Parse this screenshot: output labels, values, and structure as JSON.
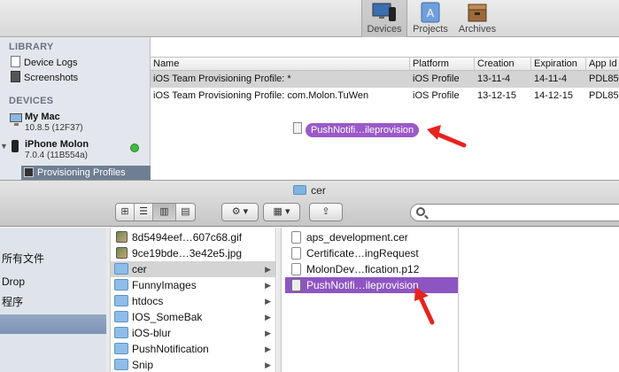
{
  "organizer": {
    "toolbar": [
      {
        "label": "Devices",
        "icon": "devices-icon",
        "active": true
      },
      {
        "label": "Projects",
        "icon": "projects-icon",
        "active": false
      },
      {
        "label": "Archives",
        "icon": "archives-icon",
        "active": false
      }
    ],
    "sidebar": {
      "library_header": "LIBRARY",
      "library_items": [
        {
          "label": "Device Logs",
          "icon": "document-icon"
        },
        {
          "label": "Screenshots",
          "icon": "screenshot-icon"
        }
      ],
      "devices_header": "DEVICES",
      "mac": {
        "name": "My Mac",
        "version": "10.8.5 (12F37)"
      },
      "iphone": {
        "name": "iPhone Molon",
        "version": "7.0.4 (11B554a)",
        "status_color": "#3fb93f"
      },
      "selected_child": "Provisioning Profiles"
    },
    "table": {
      "columns": [
        "Name",
        "Platform",
        "Creation",
        "Expiration",
        "App Id"
      ],
      "rows": [
        {
          "name": "iOS Team Provisioning Profile: *",
          "platform": "iOS Profile",
          "creation": "13-11-4",
          "expiration": "14-11-4",
          "app_id": "PDL85"
        },
        {
          "name": "iOS Team Provisioning Profile: com.Molon.TuWen",
          "platform": "iOS Profile",
          "creation": "13-12-15",
          "expiration": "14-12-15",
          "app_id": "PDL85"
        }
      ]
    },
    "drag_label": "PushNotifi…ileprovision"
  },
  "finder": {
    "title": "cer",
    "search": {
      "value": "",
      "placeholder": ""
    },
    "sidebar_items": [
      "所有文件",
      "Drop",
      "程序",
      ""
    ],
    "column1": [
      {
        "label": "8d5494eef…607c68.gif",
        "icon": "image-icon"
      },
      {
        "label": "9ce19bde…3e42e5.jpg",
        "icon": "image-icon"
      },
      {
        "label": "cer",
        "icon": "folder-icon",
        "selected": true
      },
      {
        "label": "FunnyImages",
        "icon": "folder-icon"
      },
      {
        "label": "htdocs",
        "icon": "folder-icon"
      },
      {
        "label": "IOS_SomeBak",
        "icon": "folder-icon"
      },
      {
        "label": "iOS-blur",
        "icon": "folder-icon"
      },
      {
        "label": "PushNotification",
        "icon": "folder-icon"
      },
      {
        "label": "Snip",
        "icon": "folder-icon"
      }
    ],
    "column2": [
      {
        "label": "aps_development.cer",
        "icon": "document-icon"
      },
      {
        "label": "Certificate…ingRequest",
        "icon": "document-icon"
      },
      {
        "label": "MolonDev…fication.p12",
        "icon": "document-icon"
      },
      {
        "label": "PushNotifi…ileprovision",
        "icon": "certificate-icon",
        "highlighted": true
      }
    ]
  },
  "colors": {
    "drag_highlight": "#9b59c9",
    "annotation_arrow": "#e8231e",
    "device_status": "#3fb93f"
  }
}
